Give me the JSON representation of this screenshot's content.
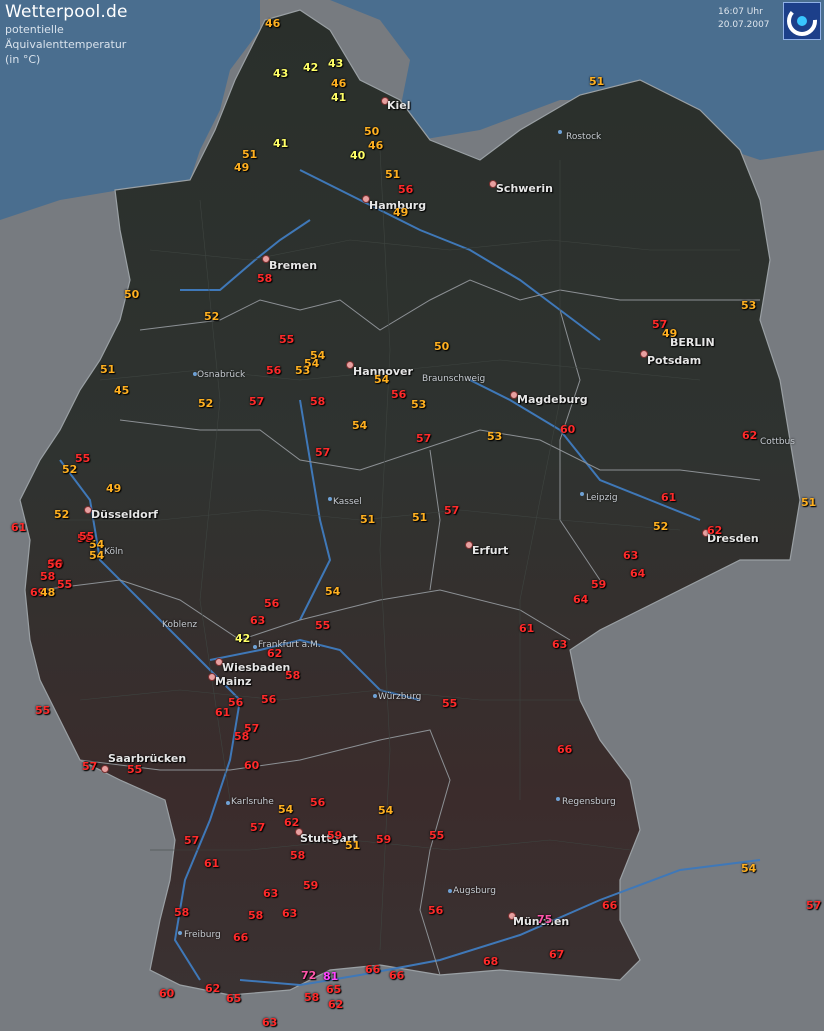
{
  "header": {
    "brand": "Wetterpool.de",
    "line1": "potentielle",
    "line2": "Äquivalenttemperatur",
    "line3": "(in °C)"
  },
  "timestamp": {
    "time": "16:07 Uhr",
    "date": "20.07.2007"
  },
  "logo_icon": "wetterpool-swirl-icon",
  "colors": {
    "sea": "#4a6e8f",
    "land": "#2b302c",
    "outside": "#777b80",
    "river": "#3f78b8",
    "border": "#9aa0a4",
    "band_35_44": "#ffff66",
    "band_45_54": "#ffb020",
    "band_55_69": "#ff2a2a",
    "band_70_79": "#ff55aa",
    "band_80_plus": "#ff44ff"
  },
  "cities": [
    {
      "name": "Kiel"
    },
    {
      "name": "Schwerin"
    },
    {
      "name": "Hamburg"
    },
    {
      "name": "Bremen"
    },
    {
      "name": "Hannover"
    },
    {
      "name": "Magdeburg"
    },
    {
      "name": "Potsdam"
    },
    {
      "name": "BERLIN"
    },
    {
      "name": "Düsseldorf"
    },
    {
      "name": "Erfurt"
    },
    {
      "name": "Dresden"
    },
    {
      "name": "Wiesbaden"
    },
    {
      "name": "Mainz"
    },
    {
      "name": "Saarbrücken"
    },
    {
      "name": "Stuttgart"
    },
    {
      "name": "München"
    }
  ],
  "towns": [
    {
      "name": "Rostock"
    },
    {
      "name": "Osnabrück"
    },
    {
      "name": "Braunschweig"
    },
    {
      "name": "Cottbus"
    },
    {
      "name": "Kassel"
    },
    {
      "name": "Leipzig"
    },
    {
      "name": "Köln"
    },
    {
      "name": "Koblenz"
    },
    {
      "name": "Frankfurt a.M."
    },
    {
      "name": "Würzburg"
    },
    {
      "name": "Regensburg"
    },
    {
      "name": "Karlsruhe"
    },
    {
      "name": "Augsburg"
    },
    {
      "name": "Freiburg"
    }
  ],
  "readings": [
    46,
    43,
    42,
    43,
    46,
    41,
    51,
    41,
    50,
    46,
    40,
    51,
    49,
    51,
    56,
    49,
    58,
    50,
    52,
    55,
    54,
    54,
    53,
    56,
    50,
    57,
    49,
    54,
    53,
    51,
    45,
    52,
    57,
    58,
    56,
    53,
    53,
    54,
    60,
    57,
    62,
    55,
    52,
    49,
    52,
    57,
    61,
    51,
    51,
    54,
    54,
    59,
    55,
    57,
    51,
    61,
    52,
    62,
    64,
    63,
    59,
    64,
    69,
    48,
    58,
    56,
    58,
    55,
    56,
    54,
    63,
    55,
    42,
    62,
    58,
    63,
    61,
    56,
    56,
    55,
    55,
    61,
    57,
    58,
    66,
    57,
    55,
    60,
    54,
    56,
    54,
    62,
    57,
    58,
    59,
    51,
    59,
    55,
    57,
    61,
    59,
    63,
    63,
    58,
    54,
    57,
    66,
    56,
    75,
    58,
    66,
    68,
    67,
    72,
    81,
    66,
    66,
    65,
    58,
    62,
    60,
    62,
    65,
    63
  ]
}
